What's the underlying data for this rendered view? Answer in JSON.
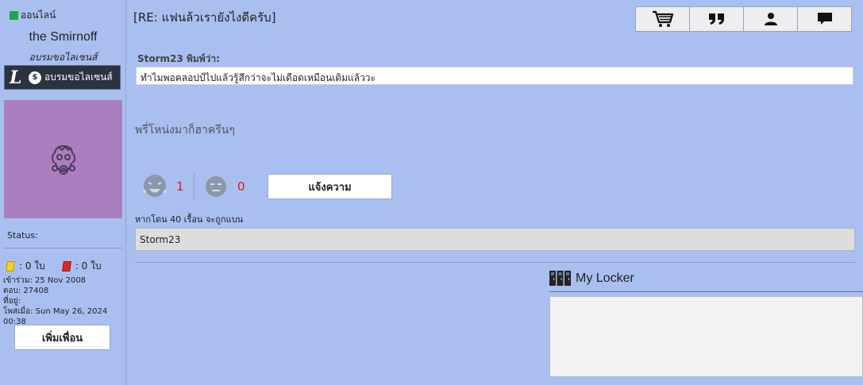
{
  "sidebar": {
    "online_label": "ออนไลน์",
    "username": "the Smirnoff",
    "user_title": "อบรมขอไลเซนส์",
    "rank_badge_text": "อบรมขอไลเซนส์",
    "status_label": "Status:",
    "yellow_cards": ": 0 ใบ",
    "red_cards": ": 0 ใบ",
    "joined": "เข้าร่วม: 25 Nov 2008",
    "posts": "ตอบ: 27408",
    "location": "ที่อยู่:",
    "posted_at": "โพสเมื่อ: Sun May 26, 2024 00:38",
    "add_friend_label": "เพิ่มเพื่อน",
    "colors": {
      "online": "#1ba84a",
      "avatar_bg": "#ab7fbf",
      "yellow_card": "#f3d01d",
      "red_card": "#e02626"
    }
  },
  "post": {
    "title": "[RE: แฟนล้วเรายังไงดีครับ]",
    "quote_author": "Storm23 พิมพ์ว่า:",
    "quote_text": "ทำไมพอคลอปป์ไปแล้วรู้สึกว่าจะไม่เดือดเหมือนเดิมแล้ววะ",
    "message": "พรี่โหน่งมาก็ฮาครีนๆ",
    "likes": "1",
    "dislikes": "0",
    "report_label": "แจ้งความ",
    "ban_note": "หากโดน 40 เรื้อน จะถูกแบน",
    "signature": "Storm23"
  },
  "toolbar": {
    "buttons": [
      "cart-icon",
      "quote-icon",
      "user-icon",
      "message-icon"
    ]
  },
  "locker": {
    "title": "My Locker"
  }
}
